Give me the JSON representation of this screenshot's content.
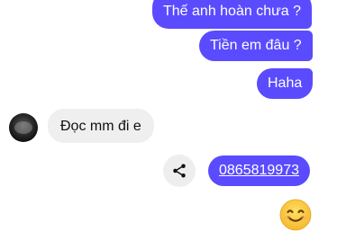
{
  "messages": {
    "outgoing": [
      {
        "text": "Thế anh hoàn chưa ?"
      },
      {
        "text": "Tiền em đâu ?"
      },
      {
        "text": "Haha"
      },
      {
        "text": "0865819973"
      }
    ],
    "incoming": [
      {
        "text": "Đọc mm đi e"
      }
    ],
    "emoji_reaction": "smiling-face-icon"
  },
  "colors": {
    "outgoing_bubble": "#5a4bff",
    "incoming_bubble": "#efefef",
    "emoji_face": "#ffc83d"
  }
}
